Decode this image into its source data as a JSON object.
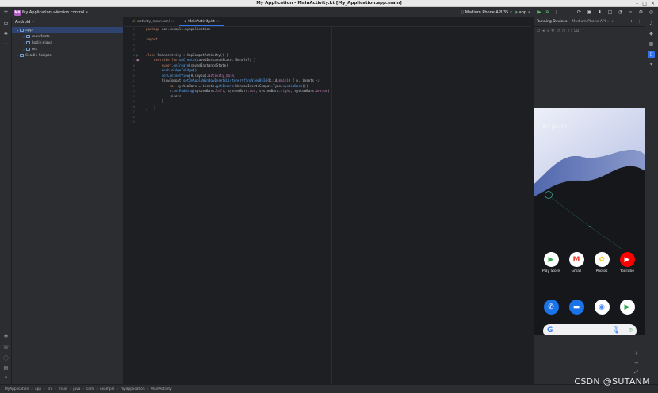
{
  "window": {
    "title": "My Application - MainActivity.kt [My_Application.app.main]"
  },
  "toolbar": {
    "project_badge": "MA",
    "project_name": "My Application",
    "vcs": "Version control",
    "device": "Medium Phone API 35",
    "run_config": "app"
  },
  "project": {
    "view_mode": "Android",
    "tree": [
      {
        "label": "app",
        "depth": 0,
        "expanded": true,
        "selected": true
      },
      {
        "label": "manifests",
        "depth": 1,
        "expanded": false
      },
      {
        "label": "kotlin+java",
        "depth": 1,
        "expanded": false
      },
      {
        "label": "res",
        "depth": 1,
        "expanded": false
      },
      {
        "label": "Gradle Scripts",
        "depth": 0,
        "expanded": false
      }
    ]
  },
  "editor": {
    "tabs": [
      {
        "label": "activity_main.xml",
        "active": false
      },
      {
        "label": "MainActivity.kt",
        "active": true
      }
    ],
    "line_numbers": [
      "1",
      "2",
      "3",
      "4",
      "5",
      "6",
      "7",
      "8",
      "9",
      "10",
      "11",
      "12",
      "13",
      "14",
      "15",
      "16",
      "17",
      "18",
      "19"
    ],
    "code": [
      "package com.example.myapplication",
      "",
      "import ...",
      "",
      "",
      "class MainActivity : AppCompatActivity() {",
      "    override fun onCreate(savedInstanceState: Bundle?) {",
      "        super.onCreate(savedInstanceState)",
      "        enableEdgeToEdge()",
      "        setContentView(R.layout.activity_main)",
      "        ViewCompat.setOnApplyWindowInsetsListener(findViewById(R.id.main)) { v, insets ->",
      "            val systemBars = insets.getInsets(WindowInsetsCompat.Type.systemBars())",
      "            v.setPadding(systemBars.left, systemBars.top, systemBars.right, systemBars.bottom)",
      "            insets",
      "        }",
      "    }",
      "}",
      "",
      ""
    ]
  },
  "running_devices": {
    "title": "Running Devices",
    "device_tab": "Medium Phone API ...",
    "phone": {
      "date_text": "Fri, Jan 10",
      "apps_row1": [
        {
          "label": "Play Store",
          "icon": "play-store-icon",
          "color": "#ffffff"
        },
        {
          "label": "Gmail",
          "icon": "gmail-icon",
          "color": "#ffffff"
        },
        {
          "label": "Photos",
          "icon": "photos-icon",
          "color": "#ffffff"
        },
        {
          "label": "YouTube",
          "icon": "youtube-icon",
          "color": "#ff0000"
        }
      ],
      "dock": [
        {
          "icon": "phone-icon",
          "color": "#1a73e8"
        },
        {
          "icon": "messages-icon",
          "color": "#1a73e8"
        },
        {
          "icon": "chrome-icon",
          "color": "#ffffff"
        },
        {
          "icon": "play-store-icon",
          "color": "#ffffff"
        }
      ],
      "search_logo": "G"
    }
  },
  "statusbar": {
    "breadcrumb": [
      "MyApplication",
      "app",
      "src",
      "main",
      "java",
      "com",
      "example",
      "myapplication",
      "MainActivity"
    ]
  },
  "watermark": "CSDN @SUTANM",
  "colors": {
    "accent": "#3574f0",
    "project_badge": "#b45fc5",
    "selection": "#2e436e"
  }
}
